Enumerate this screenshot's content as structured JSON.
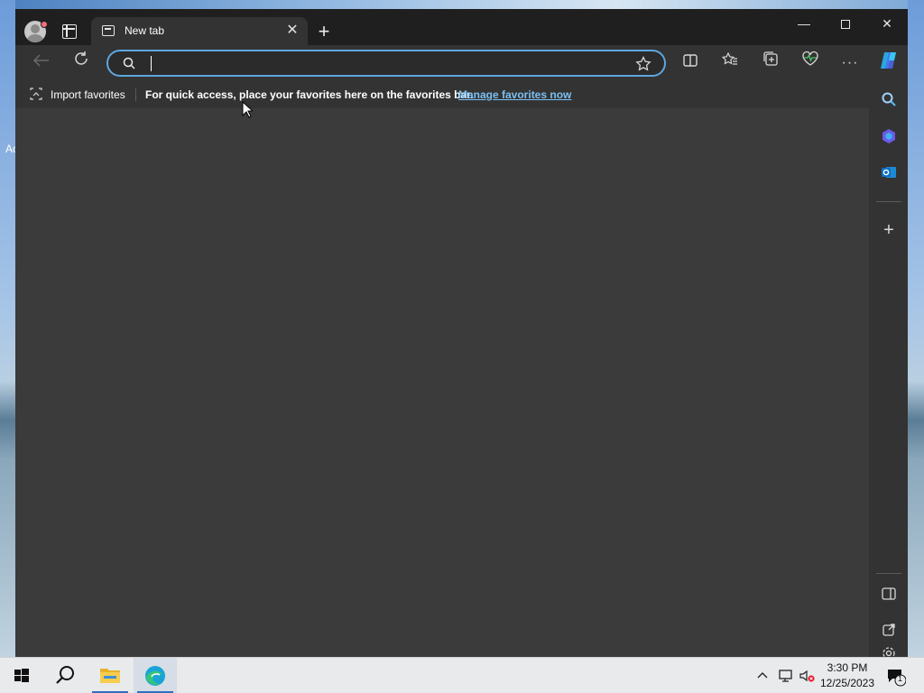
{
  "desktop": {
    "peek_text": "Ac"
  },
  "browser": {
    "tab": {
      "title": "New tab",
      "close_icon": "close-icon"
    },
    "new_tab_label": "+",
    "window_controls": {
      "minimize": "—",
      "maximize": "maximize-icon",
      "close": "✕"
    },
    "toolbar": {
      "address_value": "",
      "address_placeholder": "",
      "icons": [
        "back-icon",
        "refresh-icon",
        "search-icon",
        "star-icon",
        "split-screen-icon",
        "favorites-icon",
        "collections-icon",
        "browser-essentials-icon",
        "more-icon",
        "copilot-icon"
      ]
    },
    "favorites_bar": {
      "import_label": "Import favorites",
      "message": "For quick access, place your favorites here on the favorites bar.",
      "manage_link": "Manage favorites now"
    },
    "sidebar": {
      "icons": [
        "sidebar-search-icon",
        "copilot-sidebar-icon",
        "outlook-icon",
        "add-icon",
        "hide-sidebar-icon",
        "open-external-icon",
        "settings-icon"
      ]
    }
  },
  "taskbar": {
    "items": [
      "start-icon",
      "search-icon",
      "file-explorer-icon",
      "edge-icon"
    ],
    "clock_time": "3:30 PM",
    "clock_date": "12/25/2023",
    "notification_count": "1"
  },
  "colors": {
    "accent": "#5da7de",
    "link": "#7cc0f3",
    "content_bg": "#3b3b3b",
    "toolbar_bg": "#333333"
  }
}
